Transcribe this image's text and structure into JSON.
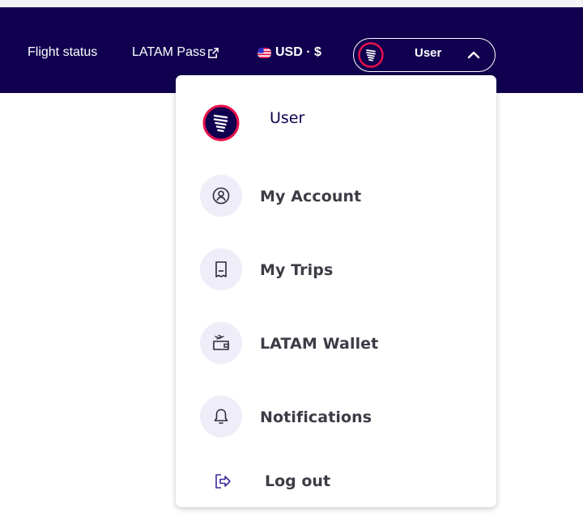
{
  "header": {
    "flight_status_label": "Flight status",
    "latam_pass_label": "LATAM Pass",
    "currency_label": "USD · $",
    "user_label": "User"
  },
  "menu": {
    "user_name": "User",
    "items": [
      {
        "label": "My Account",
        "icon": "account-icon"
      },
      {
        "label": "My Trips",
        "icon": "trips-icon"
      },
      {
        "label": "LATAM Wallet",
        "icon": "wallet-icon"
      },
      {
        "label": "Notifications",
        "icon": "bell-icon"
      },
      {
        "label": "Log out",
        "icon": "logout-icon"
      }
    ]
  },
  "colors": {
    "navbar": "#10004f",
    "accent": "#e8114b",
    "icon_bg": "#efedf8",
    "text": "#3d3b45"
  }
}
